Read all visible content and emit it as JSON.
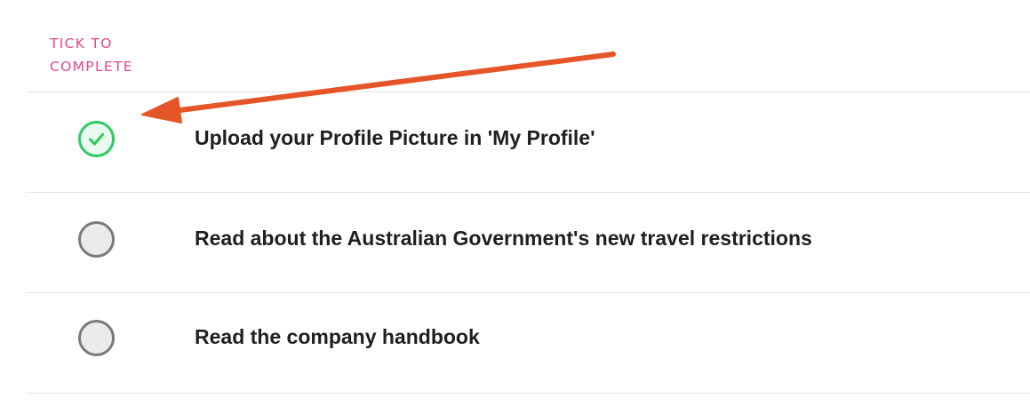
{
  "header": {
    "line1": "TICK TO",
    "line2": "COMPLETE"
  },
  "tasks": [
    {
      "label": "Upload your Profile Picture in 'My Profile'",
      "completed": true
    },
    {
      "label": "Read about the Australian Government's new travel restrictions",
      "completed": false
    },
    {
      "label": "Read the company handbook",
      "completed": false
    }
  ],
  "colors": {
    "header_accent": "#e5478a",
    "checked": "#2ecc63",
    "unchecked_border": "#7a7a7a",
    "annotation_arrow": "#e65527"
  },
  "icons": {
    "checked": "checkmark-icon",
    "annotation": "arrow-annotation"
  }
}
